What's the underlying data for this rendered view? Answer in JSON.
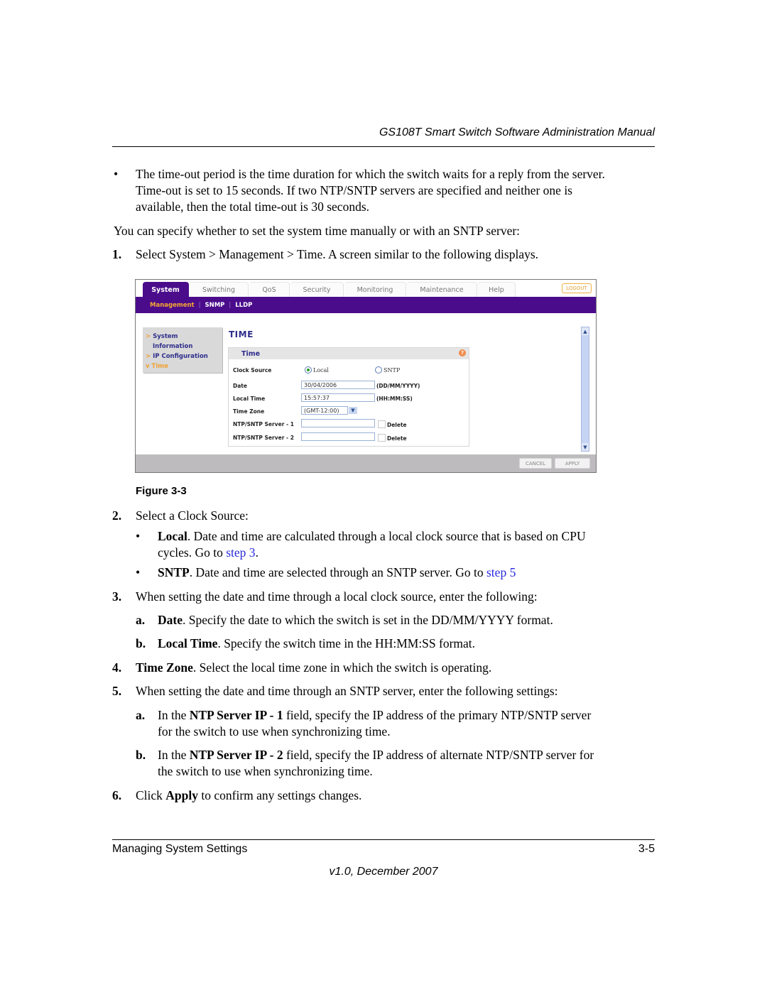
{
  "header": {
    "title": "GS108T Smart Switch Software Administration Manual"
  },
  "intro_bullet": "The time-out period is the time duration for which the switch waits for a reply from the server. Time-out is set to 15 seconds. If two NTP/SNTP servers are specified and neither one is available, then the total time-out is 30 seconds.",
  "intro_bullet_lines": [
    "The time-out period is the time duration for which the switch waits for a reply from the server.",
    "Time-out is set to 15 seconds. If two NTP/SNTP servers are specified and neither one is",
    "available, then the total time-out is 30 seconds."
  ],
  "para_specify": "You can specify whether to set the system time manually or with an SNTP server:",
  "step1": {
    "num": "1.",
    "text": "Select System > Management > Time. A screen similar to the following displays."
  },
  "ui": {
    "tabs": [
      "System",
      "Switching",
      "QoS",
      "Security",
      "Monitoring",
      "Maintenance",
      "Help"
    ],
    "active_tab": "System",
    "logout": "LOGOUT",
    "subnav": [
      "Management",
      "SNMP",
      "LLDP"
    ],
    "sidenav": {
      "system_information_1": "System",
      "system_information_2": "Information",
      "ip_configuration": "IP Configuration",
      "time": "Time"
    },
    "page_title": "TIME",
    "panel_title": "Time",
    "help_icon": "?",
    "labels": {
      "clock_source": "Clock Source",
      "date": "Date",
      "local_time": "Local Time",
      "time_zone": "Time Zone",
      "ntp1": "NTP/SNTP Server - 1",
      "ntp2": "NTP/SNTP Server - 2"
    },
    "radio_local": "Local",
    "radio_sntp": "SNTP",
    "clock_source_selected": "Local",
    "date_value": "30/04/2006",
    "date_format": "(DD/MM/YYYY)",
    "time_value": "15:57:37",
    "time_format": "(HH:MM:SS)",
    "time_zone_value": "(GMT-12:00)",
    "ntp1_value": "",
    "ntp2_value": "",
    "delete_label": "Delete",
    "cancel": "CANCEL",
    "apply": "APPLY"
  },
  "figure_caption": "Figure 3-3",
  "step2": {
    "num": "2.",
    "text": "Select a Clock Source:"
  },
  "step2_bullets": [
    {
      "bold": "Local",
      "text": ". Date and time are calculated through a local clock source that is based on CPU",
      "text2": "cycles. Go to ",
      "link": "step 3",
      "after": "."
    },
    {
      "bold": "SNTP",
      "text": ". Date and time are selected through an SNTP server. Go to ",
      "link": "step 5"
    }
  ],
  "step3": {
    "num": "3.",
    "text": "When setting the date and time through a local clock source, enter the following:"
  },
  "step3a": {
    "num": "a.",
    "bold": "Date",
    "text": ". Specify the date to which the switch is set in the DD/MM/YYYY format."
  },
  "step3b": {
    "num": "b.",
    "bold": "Local Time",
    "text": ". Specify the switch time in the HH:MM:SS format."
  },
  "step4": {
    "num": "4.",
    "bold": "Time Zone",
    "text": ". Select the local time zone in which the switch is operating."
  },
  "step5": {
    "num": "5.",
    "text": "When setting the date and time through an SNTP server, enter the following settings:"
  },
  "step5a": {
    "num": "a.",
    "pre": "In the ",
    "bold": "NTP Server IP - 1",
    "text": " field, specify the IP address of the primary NTP/SNTP server",
    "text2": "for the switch to use when synchronizing time."
  },
  "step5b": {
    "num": "b.",
    "pre": "In the ",
    "bold": "NTP Server IP - 2",
    "text": " field, specify the IP address of alternate NTP/SNTP server for",
    "text2": "the switch to use when synchronizing time."
  },
  "step6": {
    "num": "6.",
    "pre": "Click ",
    "bold": "Apply",
    "text": " to confirm any settings changes."
  },
  "footer": {
    "section": "Managing System Settings",
    "page": "3-5",
    "version": "v1.0, December 2007"
  }
}
